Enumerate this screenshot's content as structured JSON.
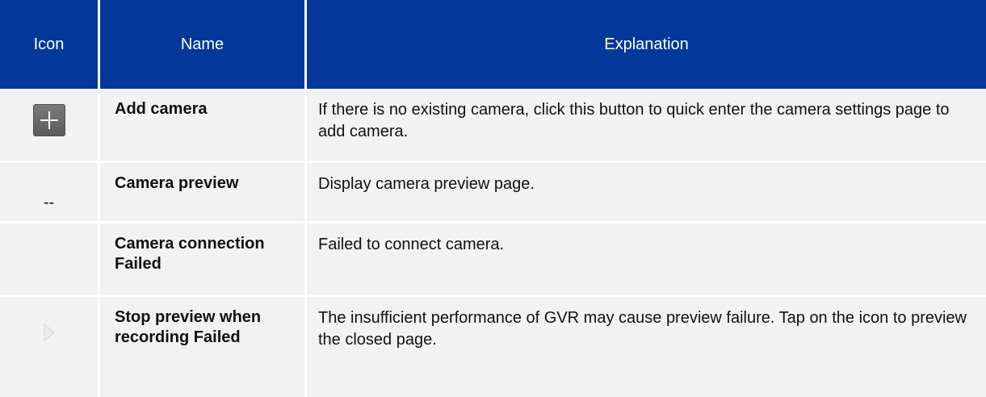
{
  "table": {
    "headers": {
      "icon": "Icon",
      "name": "Name",
      "explanation": "Explanation"
    },
    "rows": [
      {
        "icon": "plus-icon",
        "icon_text": "",
        "name": "Add camera",
        "explanation": "If there is no existing camera, click this button to quick enter the camera settings page to add camera."
      },
      {
        "icon": "",
        "icon_text": "--",
        "name": "Camera preview",
        "explanation": "Display camera preview page."
      },
      {
        "icon": "",
        "icon_text": "",
        "name": "Camera connection Failed",
        "explanation": "Failed to connect camera."
      },
      {
        "icon": "play-icon",
        "icon_text": "",
        "name": "Stop preview when recording Failed",
        "explanation": "The insufficient performance of GVR may cause preview failure. Tap on the icon to preview the closed page."
      }
    ]
  },
  "colors": {
    "header_bg": "#04389a",
    "header_text": "#ffffff",
    "row_bg": "#f2f2f2"
  }
}
